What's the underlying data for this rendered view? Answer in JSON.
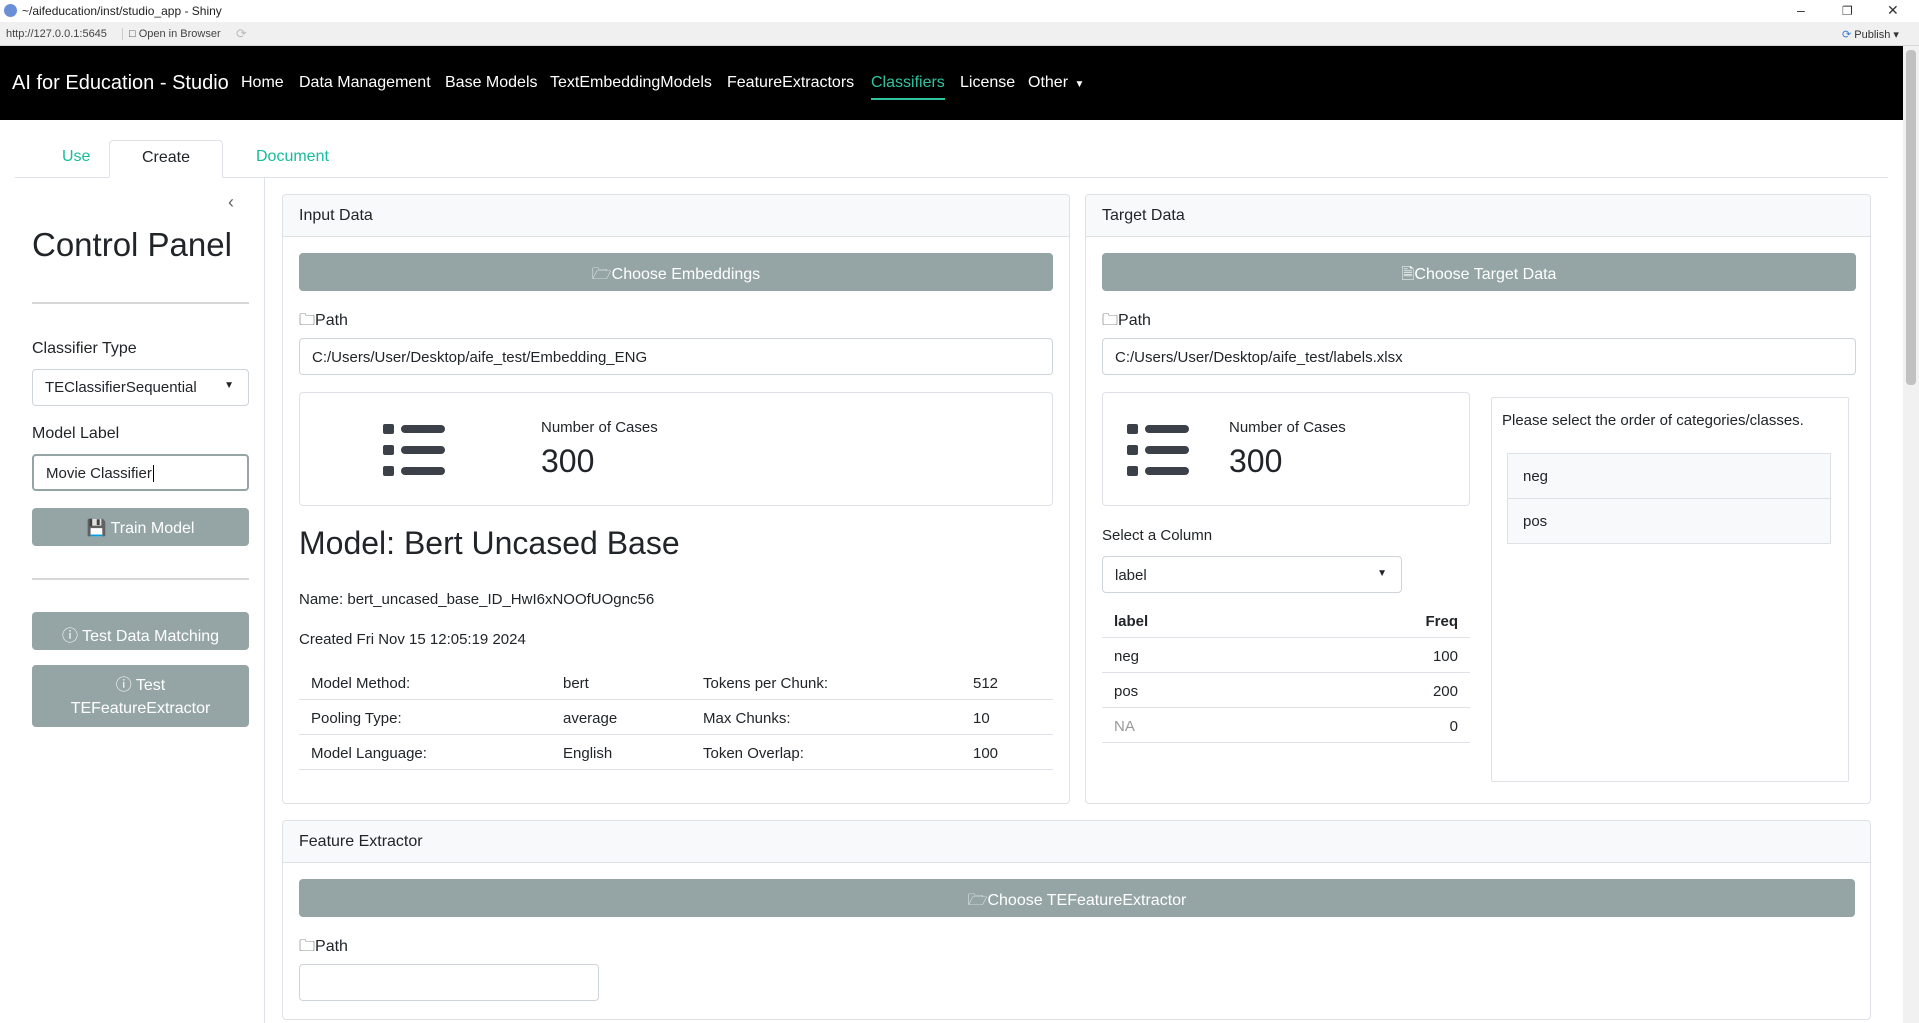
{
  "window": {
    "title": "~/aifeducation/inst/studio_app - Shiny",
    "url": "http://127.0.0.1:5645",
    "open_browser": "Open in Browser",
    "publish": "Publish"
  },
  "navbar": {
    "brand": "AI for Education - Studio",
    "items": [
      "Home",
      "Data Management",
      "Base Models",
      "TextEmbeddingModels",
      "FeatureExtractors",
      "Classifiers",
      "License",
      "Other"
    ],
    "active": "Classifiers",
    "accent": "#18bc9c"
  },
  "tabs": [
    "Use",
    "Create",
    "Document"
  ],
  "sidebar": {
    "title": "Control Panel",
    "classifier_type_label": "Classifier Type",
    "classifier_type_value": "TEClassifierSequential",
    "model_label_label": "Model Label",
    "model_label_value": "Movie Classifier",
    "train_button": "Train Model",
    "test_matching_button": "Test Data Matching",
    "test_fe_button_line1": "Test",
    "test_fe_button_line2": "TEFeatureExtractor"
  },
  "input_data": {
    "header": "Input Data",
    "choose_button": "Choose Embeddings",
    "path_label": "Path",
    "path_value": "C:/Users/User/Desktop/aife_test/Embedding_ENG",
    "cases_label": "Number of Cases",
    "cases_value": "300",
    "model_title": "Model: Bert Uncased Base",
    "name_line": "Name: bert_uncased_base_ID_HwI6xNOOfUOgnc56",
    "created_line": "Created Fri Nov 15 12:05:19 2024",
    "details": [
      [
        "Model Method:",
        "bert",
        "Tokens per Chunk:",
        "512"
      ],
      [
        "Pooling Type:",
        "average",
        "Max Chunks:",
        "10"
      ],
      [
        "Model Language:",
        "English",
        "Token Overlap:",
        "100"
      ]
    ]
  },
  "target_data": {
    "header": "Target Data",
    "choose_button": "Choose Target Data",
    "path_label": "Path",
    "path_value": "C:/Users/User/Desktop/aife_test/labels.xlsx",
    "cases_label": "Number of Cases",
    "cases_value": "300",
    "column_label": "Select a Column",
    "column_value": "label",
    "freq_headers": [
      "label",
      "Freq"
    ],
    "freq_rows": [
      [
        "neg",
        "100"
      ],
      [
        "pos",
        "200"
      ],
      [
        "NA",
        "0"
      ]
    ],
    "order_prompt": "Please select the order of categories/classes.",
    "order_items": [
      "neg",
      "pos"
    ]
  },
  "feature_extractor": {
    "header": "Feature Extractor",
    "choose_button": "Choose TEFeatureExtractor",
    "path_label": "Path",
    "path_value": ""
  }
}
